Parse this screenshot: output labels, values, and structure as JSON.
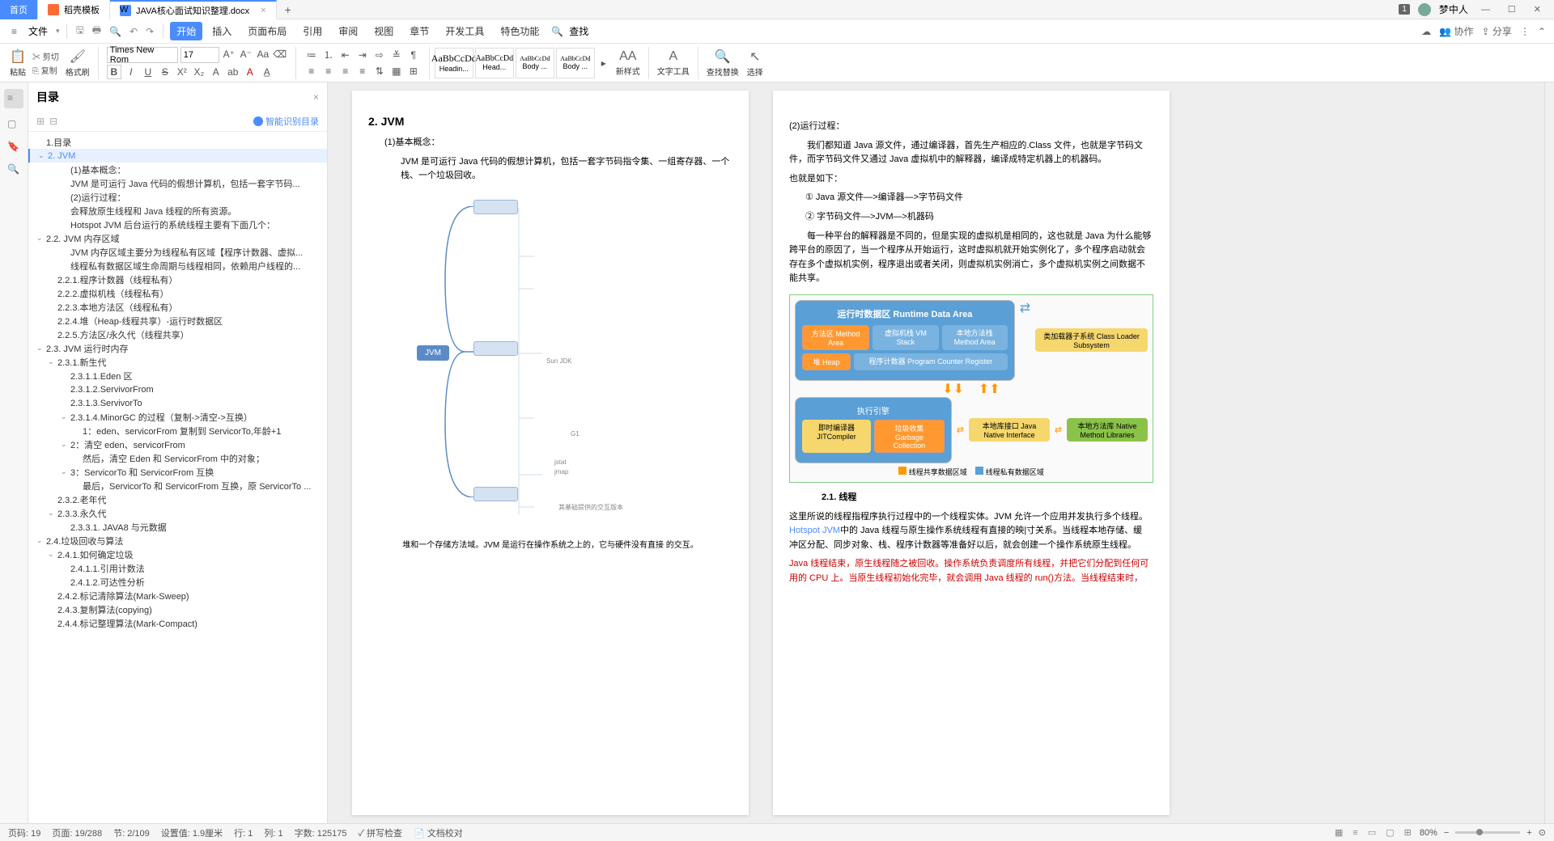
{
  "tabs": {
    "home": "首页",
    "template": "稻壳模板",
    "doc": "JAVA核心面试知识整理.docx"
  },
  "user": {
    "badge": "1",
    "name": "梦中人"
  },
  "menu": {
    "file": "文件",
    "items": [
      "开始",
      "插入",
      "页面布局",
      "引用",
      "审阅",
      "视图",
      "章节",
      "开发工具",
      "特色功能"
    ],
    "search": "查找",
    "collab": "协作",
    "share": "分享"
  },
  "ribbon": {
    "paste": "粘贴",
    "cut": "剪切",
    "copy": "复制",
    "brush": "格式刷",
    "font": "Times New Rom",
    "size": "17",
    "styles": [
      {
        "p": "AaBbCcDd",
        "n": "Headin..."
      },
      {
        "p": "AaBbCcDd",
        "n": "Head..."
      },
      {
        "p": "AaBbCcDd",
        "n": "Body ..."
      },
      {
        "p": "AaBbCcDd",
        "n": "Body ..."
      }
    ],
    "newstyle": "新样式",
    "texttool": "文字工具",
    "findreplace": "查找替换",
    "select": "选择"
  },
  "toc": {
    "title": "目录",
    "smart": "智能识别目录",
    "items": [
      {
        "t": "1.目录",
        "l": 0
      },
      {
        "t": "2. JVM",
        "l": 0,
        "a": true,
        "sel": true
      },
      {
        "t": "(1)基本概念：",
        "l": 2
      },
      {
        "t": "JVM 是可运行 Java 代码的假想计算机，包括一套字节码...",
        "l": 2
      },
      {
        "t": "(2)运行过程：",
        "l": 2
      },
      {
        "t": "会释放原生线程和 Java 线程的所有资源。",
        "l": 2
      },
      {
        "t": "Hotspot JVM 后台运行的系统线程主要有下面几个：",
        "l": 2
      },
      {
        "t": "2.2. JVM 内存区域",
        "l": 0,
        "a": true
      },
      {
        "t": "JVM 内存区域主要分为线程私有区域【程序计数器、虚拟...",
        "l": 2
      },
      {
        "t": "线程私有数据区域生命周期与线程相同，依赖用户线程的...",
        "l": 2
      },
      {
        "t": "2.2.1.程序计数器（线程私有）",
        "l": 1
      },
      {
        "t": "2.2.2.虚拟机栈（线程私有）",
        "l": 1
      },
      {
        "t": "2.2.3.本地方法区（线程私有）",
        "l": 1
      },
      {
        "t": "2.2.4.堆（Heap-线程共享）-运行时数据区",
        "l": 1
      },
      {
        "t": "2.2.5.方法区/永久代（线程共享）",
        "l": 1
      },
      {
        "t": "2.3. JVM 运行时内存",
        "l": 0,
        "a": true
      },
      {
        "t": "2.3.1.新生代",
        "l": 1,
        "a": true
      },
      {
        "t": "2.3.1.1.Eden 区",
        "l": 2
      },
      {
        "t": "2.3.1.2.ServivorFrom",
        "l": 2
      },
      {
        "t": "2.3.1.3.ServivorTo",
        "l": 2
      },
      {
        "t": "2.3.1.4.MinorGC 的过程（复制->清空->互换）",
        "l": 2,
        "a": true
      },
      {
        "t": "1：eden、servicorFrom 复制到 ServicorTo,年龄+1",
        "l": 3
      },
      {
        "t": "2：清空 eden、servicorFrom",
        "l": 2,
        "a": true
      },
      {
        "t": "然后，清空 Eden 和 ServicorFrom 中的对象；",
        "l": 3
      },
      {
        "t": "3：ServicorTo 和 ServicorFrom 互换",
        "l": 2,
        "a": true
      },
      {
        "t": "最后，ServicorTo 和 ServicorFrom 互换，原 ServicorTo ...",
        "l": 3
      },
      {
        "t": "2.3.2.老年代",
        "l": 1
      },
      {
        "t": "2.3.3.永久代",
        "l": 1,
        "a": true
      },
      {
        "t": "2.3.3.1. JAVA8 与元数据",
        "l": 2
      },
      {
        "t": "2.4.垃圾回收与算法",
        "l": 0,
        "a": true
      },
      {
        "t": "2.4.1.如何确定垃圾",
        "l": 1,
        "a": true
      },
      {
        "t": "2.4.1.1.引用计数法",
        "l": 2
      },
      {
        "t": "2.4.1.2.可达性分析",
        "l": 2
      },
      {
        "t": "2.4.2.标记清除算法(Mark-Sweep)",
        "l": 1
      },
      {
        "t": "2.4.3.复制算法(copying)",
        "l": 1
      },
      {
        "t": "2.4.4.标记整理算法(Mark-Compact)",
        "l": 1
      }
    ]
  },
  "page1": {
    "h": "2. JVM",
    "s1": "(1)基本概念：",
    "p1": "JVM 是可运行 Java 代码的假想计算机，包括一套字节码指令集、一组寄存器、一个栈、一个垃圾回收。",
    "jvm": "JVM",
    "sunjdk": "Sun JDK",
    "g1": "G1",
    "jstat": "jstat",
    "jmap": "jmap",
    "sharelbl": "其基础提供的交互版本",
    "footer": "堆和一个存储方法域。JVM 是运行在操作系统之上的，它与硬件没有直接 的交互。"
  },
  "page2": {
    "s1": "(2)运行过程：",
    "p1": "我们都知道 Java 源文件，通过编译器，首先生产相应的.Class 文件，也就是字节码文件，而字节码文件又通过 Java 虚拟机中的解释器，编译成特定机器上的机器码。",
    "p2": "也就是如下：",
    "b1": "① Java 源文件—>编译器—>字节码文件",
    "b2": "② 字节码文件—>JVM—>机器码",
    "p3": "每一种平台的解释器是不同的，但是实现的虚拟机是相同的，这也就是 Java 为什么能够 跨平台的原因了，当一个程序从开始运行，这时虚拟机就开始实例化了，多个程序启动就会 存在多个虚拟机实例，程序退出或者关闭，则虚拟机实例消亡，多个虚拟机实例之间数据不 能共享。",
    "rd": {
      "title": "运行时数据区 Runtime Data Area",
      "method": "方法区\nMethod Area",
      "vmstack": "虚拟机栈\nVM Stack",
      "native": "本地方法栈\nMethod Area",
      "heap": "堆\nHeap",
      "pc": "程序计数器\nProgram Counter Register",
      "loader": "类加载器子系统\nClass Loader Subsystem",
      "exec": "执行引擎",
      "jit": "即时编译器\nJITCompiler",
      "gc": "垃圾收集\nGarbage Collection",
      "jni": "本地库接口\nJava Native Interface",
      "natlib": "本地方法库\nNative Method Libraries",
      "shared": "线程共享数据区域",
      "private": "线程私有数据区域"
    },
    "caption": "2.1. 线程",
    "p4a": "这里所说的线程指程序执行过程中的一个线程实体。JVM 允许一个应用并发执行多个线程。",
    "p4b": "Hotspot JVM",
    "p4c": "中的 Java 线程与原生操作系统线程有直接的映|寸关系。当线程本地存储、缓 冲区分配、同步对象、栈、程序计数器等准备好以后，就会创建一个操作系统原生线程。",
    "p5": "Java 线程结束，原生线程随之被回收。操作系统负责调度所有线程，并把它们分配到任何可 用的 CPU 上。当原生线程初始化完毕，就会调用 Java 线程的 run()方法。当线程结束时，"
  },
  "status": {
    "page": "页码: 19",
    "pages": "页面: 19/288",
    "sec": "节: 2/109",
    "set": "设置值: 1.9厘米",
    "line": "行: 1",
    "col": "列: 1",
    "words": "字数: 125175",
    "spell": "拼写检查",
    "check": "文档校对",
    "zoom": "80%"
  }
}
